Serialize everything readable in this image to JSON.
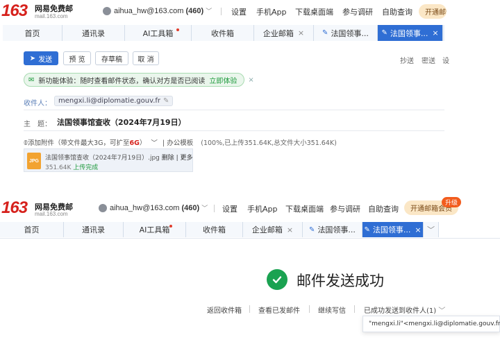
{
  "screen1": {
    "logo": {
      "number": "163",
      "brand": "网易免费邮",
      "domain": "mail.163.com"
    },
    "account": {
      "email": "aihua_hw@163.com",
      "unread": "(460)",
      "chevron": "﹀"
    },
    "topnav": [
      "设置",
      "手机App",
      "下载桌面端",
      "参与调研",
      "自助查询"
    ],
    "vip_label": "开通邮箱",
    "tabs": [
      "首页",
      "通讯录",
      "AI工具箱",
      "收件箱",
      "企业邮箱",
      "法国领事...",
      "法国领事..."
    ],
    "toolbar": {
      "send": "发送",
      "preview": "预 览",
      "draft": "存草稿",
      "cancel": "取 消"
    },
    "right_links": [
      "抄送",
      "密送",
      "设"
    ],
    "banner": {
      "text": "新功能体验：随时查看邮件状态，确认对方是否已阅读",
      "action": "立即体验",
      "close": "×"
    },
    "recipient": {
      "label": "收件人：",
      "value": "mengxi.li@diplomatie.gouv.fr"
    },
    "subject": {
      "label": "主　题：",
      "value": "法国领事馆查收（2024年7月19日）"
    },
    "attach": {
      "prefix": "添加附件（带文件最大3G，可扩至",
      "limit": "6G",
      "suffix": "）",
      "office": "办公模板",
      "status": "(100%,已上传351.64K,总文件大小351.64K)"
    },
    "file": {
      "name": "法国领事馆查收（2024年7月19日）.jpg",
      "actions": "删除 | 更多",
      "size": "351.64K",
      "state": "上传完成",
      "type": "JPG"
    }
  },
  "screen2": {
    "logo": {
      "number": "163",
      "brand": "网易免费邮",
      "domain": "mail.163.com"
    },
    "account": {
      "email": "aihua_hw@163.com",
      "unread": "(460)",
      "chevron": "﹀"
    },
    "topnav": [
      "设置",
      "手机App",
      "下载桌面端",
      "参与调研",
      "自助查询"
    ],
    "vip_label": "开通邮箱会员",
    "vip_badge": "升级",
    "tabs": [
      "首页",
      "通讯录",
      "AI工具箱",
      "收件箱",
      "企业邮箱",
      "法国领事...",
      "法国领事..."
    ],
    "success": "邮件发送成功",
    "links": [
      "返回收件箱",
      "查看已发邮件",
      "继续写信",
      "已成功发送到收件人(1)"
    ],
    "popup": "\"mengxi.li\"<mengxi.li@diplomatie.gouv.fr>"
  },
  "colors": {
    "accent": "#2f6ed4",
    "brand_red": "#d6211c",
    "success_green": "#1aa251"
  }
}
